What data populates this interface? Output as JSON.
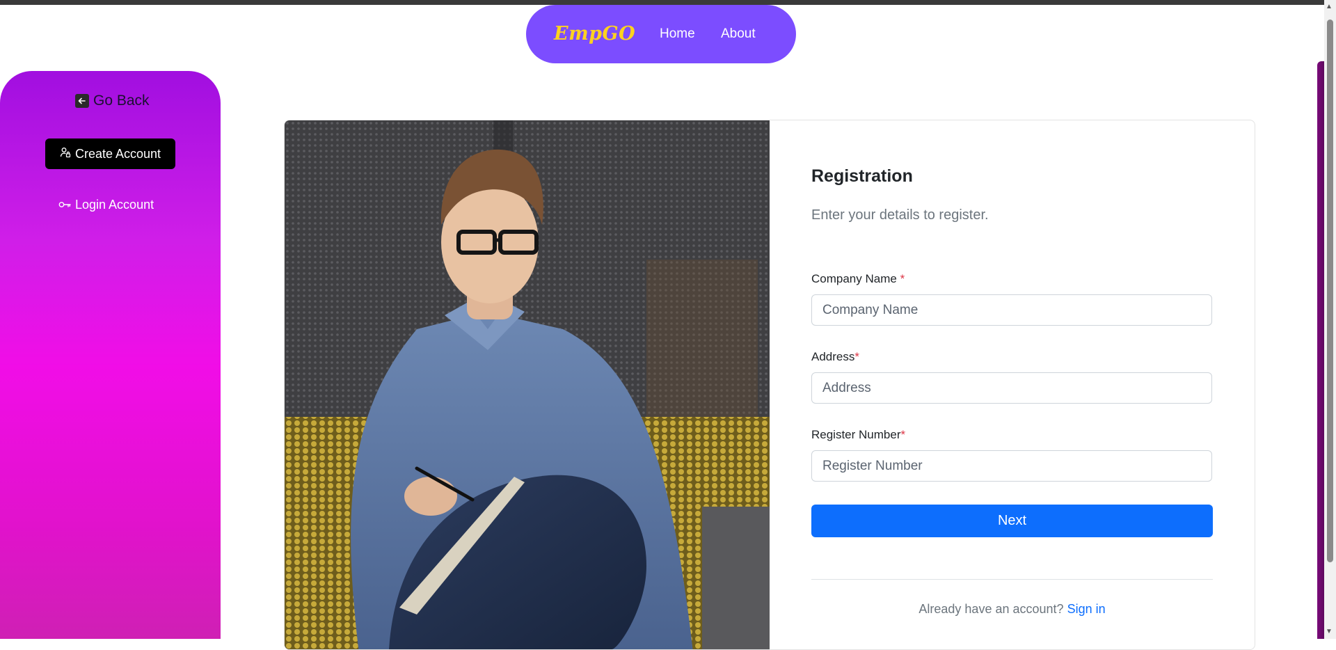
{
  "navbar": {
    "brand": "EmpGO",
    "links": [
      "Home",
      "About"
    ]
  },
  "sidebar": {
    "go_back_label": "Go Back",
    "create_account_label": "Create Account",
    "login_account_label": "Login Account"
  },
  "form": {
    "title": "Registration",
    "subtitle": "Enter your details to register.",
    "fields": [
      {
        "label": "Company Name",
        "required_mark": "*",
        "placeholder": "Company Name",
        "value": ""
      },
      {
        "label": "Address",
        "required_mark": "*",
        "placeholder": "Address",
        "value": ""
      },
      {
        "label": "Register Number",
        "required_mark": "*",
        "placeholder": "Register Number",
        "value": ""
      }
    ],
    "next_label": "Next",
    "signin_prompt": "Already have an account?",
    "signin_link": "Sign in"
  },
  "icons": {
    "go_back": "arrow-left-square-icon",
    "create_account": "person-lock-icon",
    "login_account": "key-icon"
  },
  "colors": {
    "navbar_bg": "#7c4dff",
    "brand": "#ffd21f",
    "primary": "#0d6efd",
    "sidebar_gradient": [
      "#a10fe0",
      "#f10de7",
      "#cf20b4"
    ],
    "required": "#dc3545"
  }
}
